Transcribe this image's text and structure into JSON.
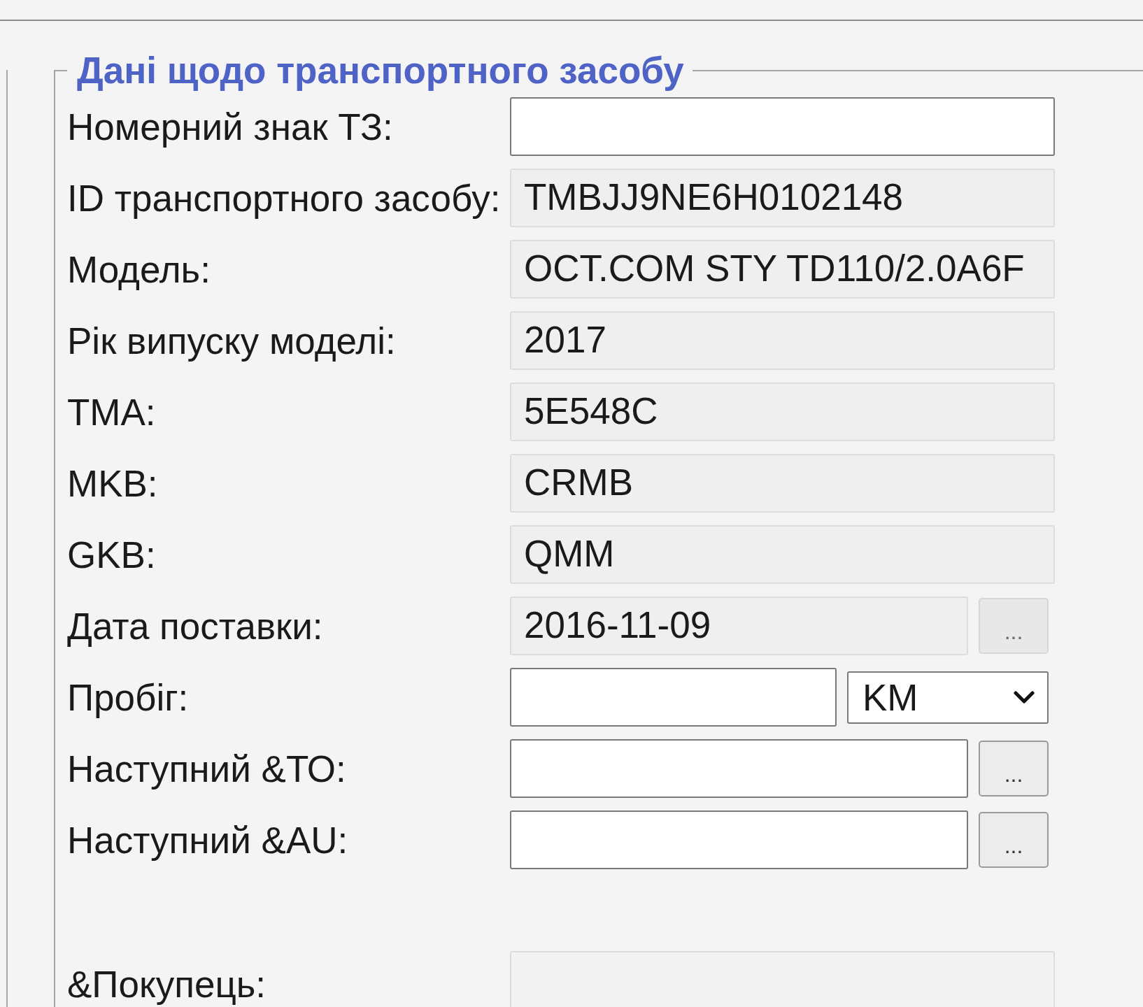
{
  "group": {
    "title": "Дані щодо транспортного засобу",
    "rows": [
      {
        "label": "Номерний знак ТЗ:",
        "field": {
          "readonly": false
        }
      },
      {
        "label": "ID транспортного засобу:",
        "field": {
          "value": "TMBJJ9NE6H0102148",
          "readonly": true
        }
      },
      {
        "label": "Модель:",
        "field": {
          "value": "OCT.COM STY TD110/2.0A6F",
          "readonly": true
        }
      },
      {
        "label": "Рік випуску моделі:",
        "field": {
          "value": "2017",
          "readonly": true
        }
      },
      {
        "label": "TMA:",
        "field": {
          "value": "5E548C",
          "readonly": true
        }
      },
      {
        "label": "MKB:",
        "field": {
          "value": "CRMB",
          "readonly": true
        }
      },
      {
        "label": "GKB:",
        "field": {
          "value": "QMM",
          "readonly": true
        }
      },
      {
        "label": "Дата поставки:",
        "field": {
          "value": "2016-11-09",
          "readonly": true
        },
        "button": {
          "label": "...",
          "disabled": true
        }
      },
      {
        "label": "Пробіг:",
        "field": {
          "readonly": false
        },
        "unit_select": {
          "value": "KM"
        }
      },
      {
        "label": "Наступний &ТО:",
        "field": {
          "readonly": false
        },
        "button": {
          "label": "...",
          "disabled": false
        }
      },
      {
        "label": "Наступний &AU:",
        "field": {
          "readonly": false
        },
        "button": {
          "label": "...",
          "disabled": false
        }
      }
    ],
    "buyer": {
      "label": "&Покупець:",
      "field": {
        "readonly": true
      }
    }
  }
}
